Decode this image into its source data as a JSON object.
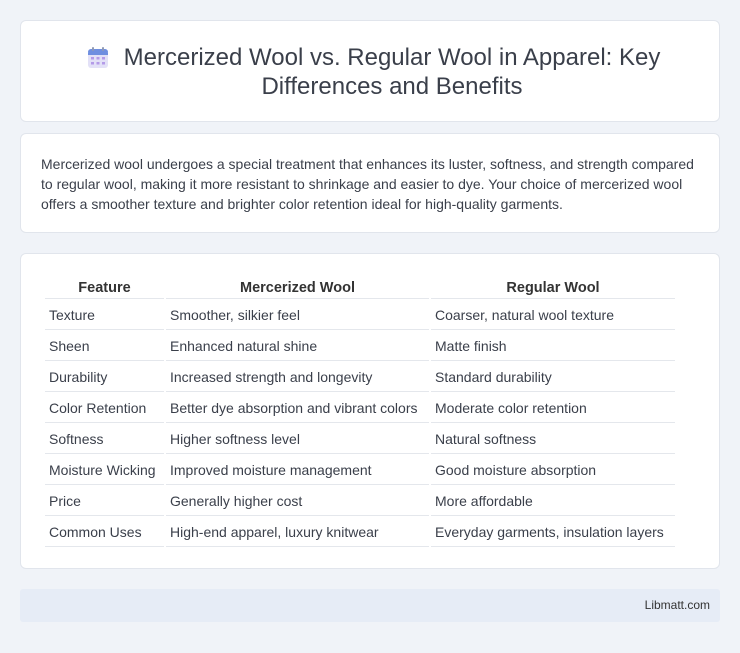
{
  "header": {
    "title": "Mercerized Wool vs. Regular Wool in Apparel: Key Differences and Benefits",
    "icon": "calendar-icon"
  },
  "intro": {
    "text": "Mercerized wool undergoes a special treatment that enhances its luster, softness, and strength compared to regular wool, making it more resistant to shrinkage and easier to dye. Your choice of mercerized wool offers a smoother texture and brighter color retention ideal for high-quality garments."
  },
  "table": {
    "headers": [
      "Feature",
      "Mercerized Wool",
      "Regular Wool"
    ],
    "rows": [
      [
        "Texture",
        "Smoother, silkier feel",
        "Coarser, natural wool texture"
      ],
      [
        "Sheen",
        "Enhanced natural shine",
        "Matte finish"
      ],
      [
        "Durability",
        "Increased strength and longevity",
        "Standard durability"
      ],
      [
        "Color Retention",
        "Better dye absorption and vibrant colors",
        "Moderate color retention"
      ],
      [
        "Softness",
        "Higher softness level",
        "Natural softness"
      ],
      [
        "Moisture Wicking",
        "Improved moisture management",
        "Good moisture absorption"
      ],
      [
        "Price",
        "Generally higher cost",
        "More affordable"
      ],
      [
        "Common Uses",
        "High-end apparel, luxury knitwear",
        "Everyday garments, insulation layers"
      ]
    ]
  },
  "footer": {
    "text": "Libmatt.com"
  },
  "colors": {
    "background": "#f0f3f8",
    "card": "#ffffff",
    "footer": "#e6ecf6"
  }
}
